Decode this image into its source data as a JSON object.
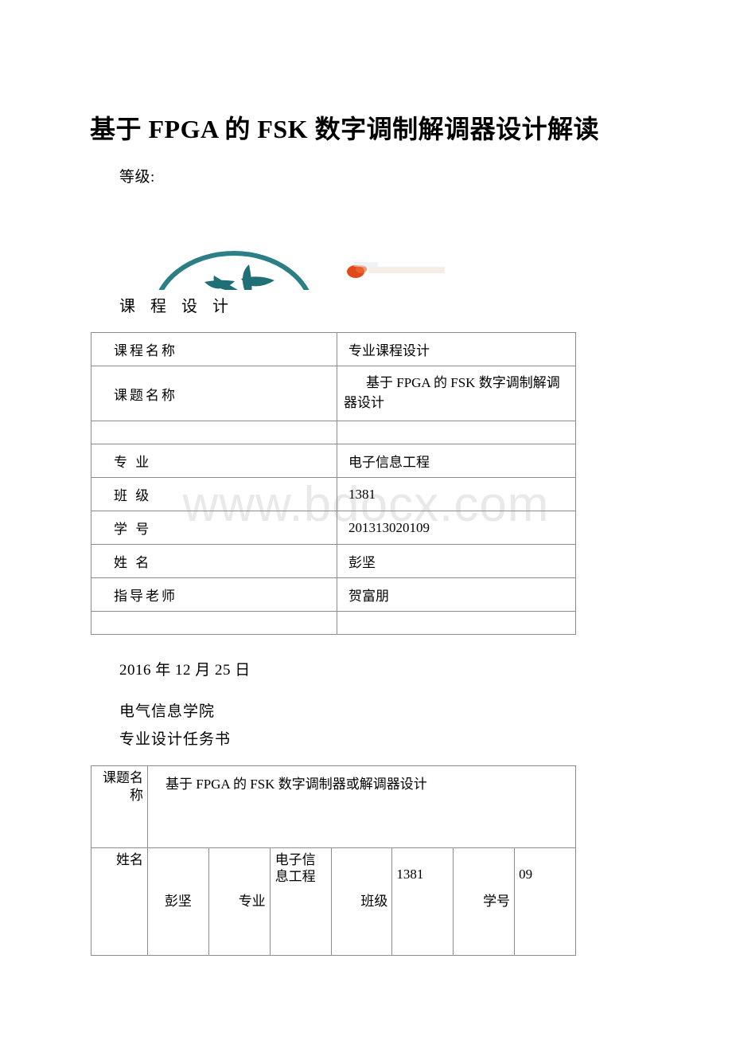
{
  "document": {
    "title": "基于 FPGA 的 FSK 数字调制解调器设计解读",
    "grade_label": "等级:",
    "course_design_heading": "课 程 设 计",
    "date_line": "2016 年 12 月 25 日",
    "department_line": "电气信息学院",
    "task_sheet_heading": "专业设计任务书",
    "watermark": "www.bdocx.com"
  },
  "logo": {
    "name": "university-emblem",
    "arc_color": "#2b7f85",
    "blob_color": "#e04a1a",
    "calligraphy": "工 程"
  },
  "course_info_table": {
    "rows": [
      {
        "label": "课程名称",
        "value": "专业课程设计",
        "style": "normal"
      },
      {
        "label": "课题名称",
        "value": "基于 FPGA 的 FSK 数字调制解调器设计",
        "style": "tall"
      },
      {
        "label": "",
        "value": "",
        "style": "blank"
      },
      {
        "label": "专 业",
        "value": "电子信息工程",
        "style": "normal"
      },
      {
        "label": "班 级",
        "value": "1381",
        "style": "normal"
      },
      {
        "label": "学 号",
        "value": "201313020109",
        "style": "normal"
      },
      {
        "label": "姓 名",
        "value": "彭坚",
        "style": "normal"
      },
      {
        "label": "指导老师",
        "value": "贺富朋",
        "style": "normal"
      },
      {
        "label": "",
        "value": "",
        "style": "blank"
      }
    ]
  },
  "task_sheet_table": {
    "topic_label": "课题名称",
    "topic_value": "基于 FPGA 的 FSK 数字调制器或解调器设计",
    "fields": [
      {
        "label": "姓名",
        "value": "彭坚"
      },
      {
        "label": "专业",
        "value": "电子信息工程"
      },
      {
        "label": "班级",
        "value": "1381"
      },
      {
        "label": "学号",
        "value": "09"
      }
    ]
  },
  "colors": {
    "table_border": "#8c8c8c",
    "text": "#000000",
    "watermark": "#e9e9e9",
    "logo_teal": "#2b7f85",
    "logo_orange": "#e04a1a"
  }
}
